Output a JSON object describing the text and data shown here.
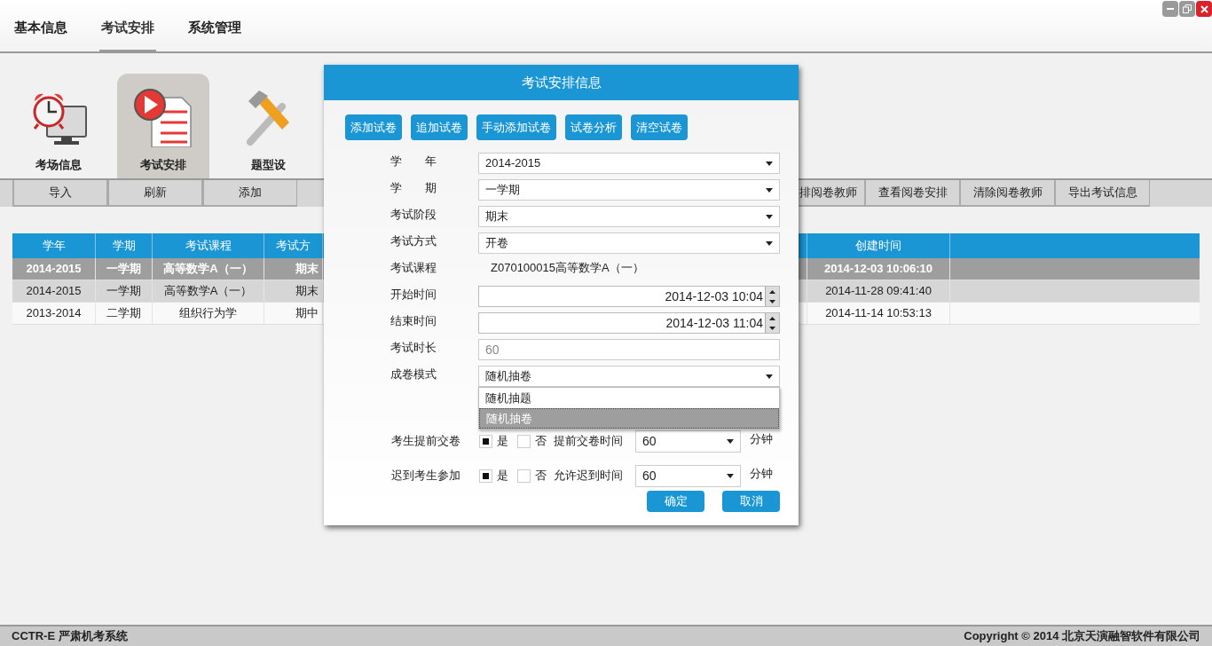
{
  "menu": [
    {
      "label": "基本信息",
      "selected": false
    },
    {
      "label": "考试安排",
      "selected": true
    },
    {
      "label": "系统管理",
      "selected": false
    }
  ],
  "modules": [
    {
      "label": "考场信息",
      "kind": "clock",
      "selected": false
    },
    {
      "label": "考试安排",
      "kind": "play",
      "selected": true
    },
    {
      "label": "题型设",
      "kind": "tools",
      "selected": false
    }
  ],
  "toolbar_left": [
    "导入",
    "刷新",
    "添加"
  ],
  "toolbar_right": [
    "排阅卷教师",
    "查看阅卷安排",
    "清除阅卷教师",
    "导出考试信息"
  ],
  "table": {
    "columns_left": [
      "学年",
      "学期",
      "考试课程",
      "考试方"
    ],
    "columns_right": [
      "创建时间"
    ],
    "rows": [
      {
        "selected": true,
        "hovered": false,
        "left": [
          "2014-2015",
          "一学期",
          "高等数学A（一）",
          "期末"
        ],
        "right": [
          "2014-12-03 10:06:10"
        ]
      },
      {
        "selected": false,
        "hovered": true,
        "left": [
          "2014-2015",
          "一学期",
          "高等数学A（一）",
          "期末"
        ],
        "right": [
          "2014-11-28 09:41:40"
        ]
      },
      {
        "selected": false,
        "hovered": false,
        "left": [
          "2013-2014",
          "二学期",
          "组织行为学",
          "期中"
        ],
        "right": [
          "2014-11-14 10:53:13"
        ]
      }
    ]
  },
  "dialog": {
    "title": "考试安排信息",
    "actions": [
      "添加试卷",
      "追加试卷",
      "手动添加试卷",
      "试卷分析",
      "清空试卷"
    ],
    "fields": [
      {
        "label": "学　　年",
        "kind": "select",
        "value": "2014-2015"
      },
      {
        "label": "学　　期",
        "kind": "select",
        "value": "一学期"
      },
      {
        "label": "考试阶段",
        "kind": "select",
        "value": "期末"
      },
      {
        "label": "考试方式",
        "kind": "select",
        "value": "开卷"
      },
      {
        "label": "考试课程",
        "kind": "static",
        "value": "Z070100015高等数学A（一）"
      },
      {
        "label": "开始时间",
        "kind": "datetime",
        "value": "2014-12-03 10:04"
      },
      {
        "label": "结束时间",
        "kind": "datetime",
        "value": "2014-12-03 11:04"
      },
      {
        "label": "考试时长",
        "kind": "readonly",
        "value": "60"
      },
      {
        "label": "成卷模式",
        "kind": "select",
        "value": "随机抽卷",
        "expanded": true
      }
    ],
    "dropdown_options": [
      {
        "label": "随机抽题",
        "selected": false
      },
      {
        "label": "随机抽卷",
        "selected": true
      }
    ],
    "options": [
      {
        "label": "考生提前交卷",
        "yes": "是",
        "yes_checked": true,
        "no": "否",
        "no_checked": false,
        "time_label": "提前交卷时间",
        "value": "60",
        "unit": "分钟"
      },
      {
        "label": "迟到考生参加",
        "yes": "是",
        "yes_checked": true,
        "no": "否",
        "no_checked": false,
        "time_label": "允许迟到时间",
        "value": "60",
        "unit": "分钟"
      }
    ],
    "buttons": [
      "确定",
      "取消"
    ]
  },
  "footer": {
    "left": "CCTR-E 严肃机考系统",
    "right": "Copyright © 2014 北京天演融智软件有限公司"
  }
}
